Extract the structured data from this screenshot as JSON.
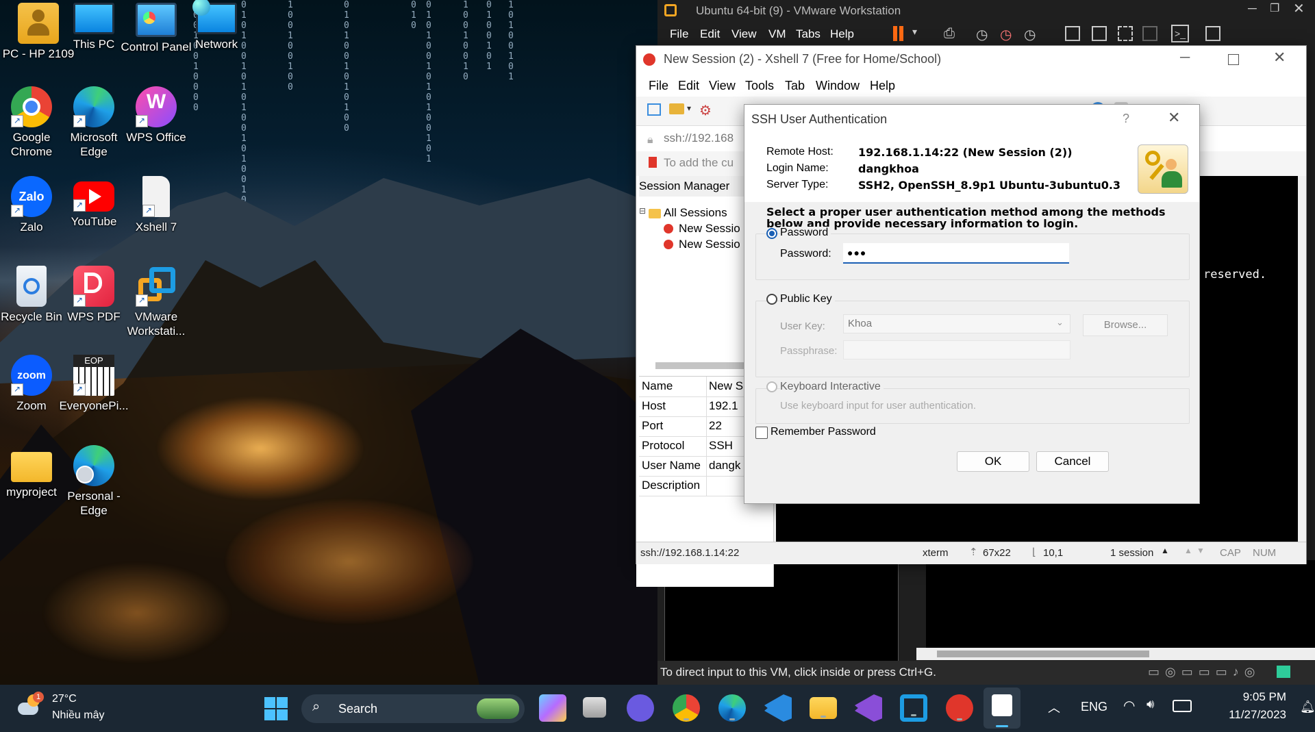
{
  "desktop": {
    "icons": [
      {
        "label": "PC - HP 2109",
        "icon": "user-folder-icon"
      },
      {
        "label": "This PC",
        "icon": "monitor-icon"
      },
      {
        "label": "Control Panel",
        "icon": "control-panel-icon"
      },
      {
        "label": "Network",
        "icon": "network-icon"
      },
      {
        "label": "Google Chrome",
        "icon": "chrome-icon"
      },
      {
        "label": "Microsoft Edge",
        "icon": "edge-icon"
      },
      {
        "label": "WPS Office",
        "icon": "wps-office-icon"
      },
      {
        "label": "Zalo",
        "icon": "zalo-icon"
      },
      {
        "label": "YouTube",
        "icon": "youtube-icon"
      },
      {
        "label": "Xshell 7",
        "icon": "blank-file-icon"
      },
      {
        "label": "Recycle Bin",
        "icon": "recycle-bin-icon"
      },
      {
        "label": "WPS PDF",
        "icon": "wps-pdf-icon"
      },
      {
        "label": "VMware Workstati...",
        "icon": "vmware-icon"
      },
      {
        "label": "Zoom",
        "icon": "zoom-icon"
      },
      {
        "label": "EveryonePi...",
        "icon": "everyonepiano-icon"
      },
      {
        "label": "myproject",
        "icon": "folder-icon"
      },
      {
        "label": "Personal - Edge",
        "icon": "edge-profile-icon"
      }
    ],
    "zalo_text": "Zalo",
    "zoom_text": "zoom",
    "eop_text": "EOP"
  },
  "vmware": {
    "title": "Ubuntu 64-bit (9) - VMware Workstation",
    "menu": [
      "File",
      "Edit",
      "View",
      "VM",
      "Tabs",
      "Help"
    ],
    "status_text": "To direct input to this VM, click inside or press Ctrl+G."
  },
  "xshell": {
    "title": "New Session (2) - Xshell 7 (Free for Home/School)",
    "menu": [
      "File",
      "Edit",
      "View",
      "Tools",
      "Tab",
      "Window",
      "Help"
    ],
    "address": "ssh://192.168",
    "hint": "To add the cu",
    "session_manager": "Session Manager",
    "tree": {
      "root": "All Sessions",
      "items": [
        "New Sessio",
        "New Sessio"
      ]
    },
    "properties": [
      {
        "key": "Name",
        "value": "New S"
      },
      {
        "key": "Host",
        "value": "192.1"
      },
      {
        "key": "Port",
        "value": "22"
      },
      {
        "key": "Protocol",
        "value": "SSH"
      },
      {
        "key": "User Name",
        "value": "dangk"
      },
      {
        "key": "Description",
        "value": ""
      }
    ],
    "terminal_text": "reserved.",
    "status": {
      "address": "ssh://192.168.1.14:22",
      "term": "xterm",
      "size": "67x22",
      "cursor": "10,1",
      "sessions": "1 session",
      "cap": "CAP",
      "num": "NUM"
    }
  },
  "dialog": {
    "title": "SSH User Authentication",
    "help": "?",
    "remote_host_label": "Remote Host:",
    "remote_host": "192.168.1.14:22 (New Session (2))",
    "login_name_label": "Login Name:",
    "login_name": "dangkhoa",
    "server_type_label": "Server Type:",
    "server_type": "SSH2, OpenSSH_8.9p1 Ubuntu-3ubuntu0.3",
    "instruction": "Select a proper user authentication method among the methods below and provide necessary information to login.",
    "password_option": "Password",
    "password_label": "Password:",
    "password_value": "●●●",
    "pubkey_option": "Public Key",
    "user_key_label": "User Key:",
    "user_key_value": "Khoa",
    "browse": "Browse...",
    "passphrase_label": "Passphrase:",
    "kbd_option": "Keyboard Interactive",
    "kbd_desc": "Use keyboard input for user authentication.",
    "remember": "Remember Password",
    "ok": "OK",
    "cancel": "Cancel",
    "selected_method": "Password"
  },
  "taskbar": {
    "weather_temp": "27°C",
    "weather_desc": "Nhiều mây",
    "weather_badge": "1",
    "search": "Search",
    "lang": "ENG",
    "time": "9:05 PM",
    "date": "11/27/2023",
    "pinned": [
      "windows-start-icon",
      "search-box",
      "copilot-icon",
      "task-view-icon",
      "teams-icon",
      "chrome-icon",
      "edge-icon",
      "vscode-icon",
      "file-explorer-icon",
      "visual-studio-icon",
      "vmware-icon",
      "xshell-icon",
      "snipping-tool-icon"
    ]
  }
}
